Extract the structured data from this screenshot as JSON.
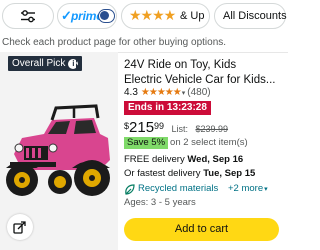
{
  "filters": {
    "filter_icon": "sliders-icon",
    "prime_label": "prime",
    "prime_check": "✓",
    "stars_label": "& Up",
    "stars_icons": "★★★★",
    "discounts_label": "All Discounts"
  },
  "hint": "Check each product page for other buying options.",
  "product": {
    "badge": "Overall Pick",
    "badge_info": "i",
    "title_line1": "24V Ride on Toy, Kids",
    "title_line2": "Electric Vehicle Car for Kids...",
    "rating": "4.3",
    "rating_stars": "★★★★★",
    "rating_caret": "▾",
    "rating_count": "(480)",
    "deal": "Ends in 13:23:28",
    "price_symbol": "$",
    "price_whole": "215",
    "price_fraction": "99",
    "list_label": "List:",
    "list_price": "$239.99",
    "save_badge": "Save 5%",
    "save_text": "on 2 select item(s)",
    "delivery_prefix": "FREE delivery ",
    "delivery_date": "Wed, Sep 16",
    "fastest_prefix": "Or fastest delivery ",
    "fastest_date": "Tue, Sep 15",
    "recycled_label": "Recycled materials",
    "recycled_more": "+2 more",
    "recycled_caret": "▾",
    "ages": "Ages: 3 - 5 years",
    "add_to_cart": "Add to cart",
    "image_desc": "pink-jeep-ride-on-car",
    "share_icon": "share-icon"
  },
  "colors": {
    "prime_blue": "#1399ff",
    "star_orange": "#f0a022",
    "deal_red": "#cc0c39",
    "save_green": "#7fda69",
    "link_teal": "#007185",
    "cart_yellow": "#ffd814",
    "badge_navy": "#232f3e"
  }
}
